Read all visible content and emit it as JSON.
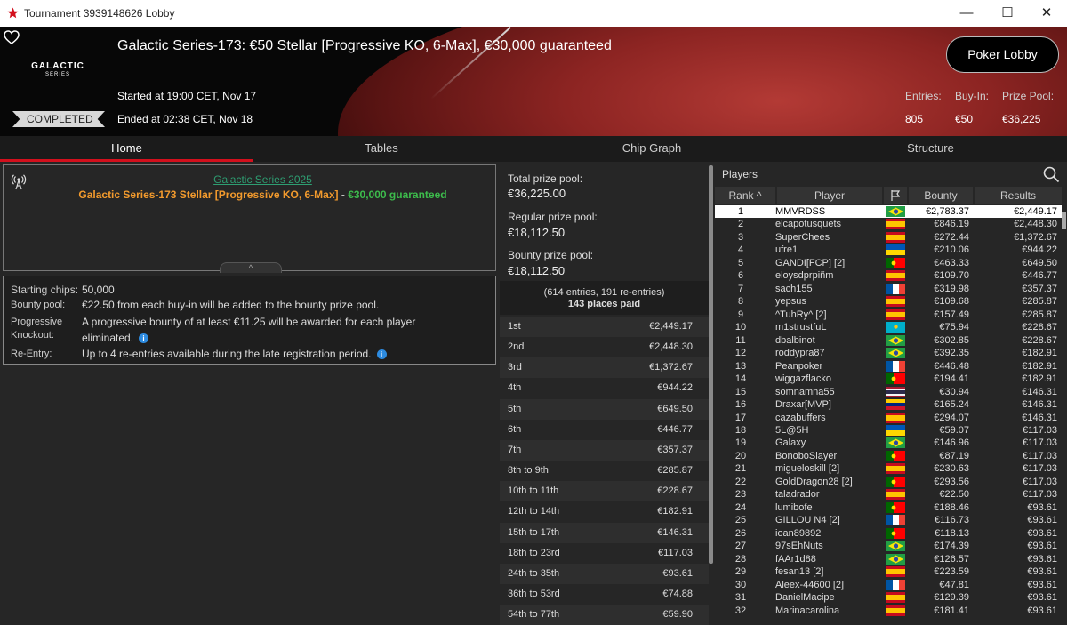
{
  "window": {
    "title": "Tournament 3939148626 Lobby",
    "minimize": "—",
    "maximize": "☐",
    "close": "✕"
  },
  "banner": {
    "logo_line1": "GALACTIC",
    "logo_line2": "SERIES",
    "title": "Galactic Series-173: €50 Stellar [Progressive KO, 6-Max], €30,000 guaranteed",
    "started": "Started at 19:00 CET, Nov 17",
    "ended": "Ended at 02:38 CET, Nov 18",
    "status": "COMPLETED",
    "lobby_button": "Poker Lobby",
    "stats": [
      {
        "label": "Entries:",
        "value": "805"
      },
      {
        "label": "Buy-In:",
        "value": "€50"
      },
      {
        "label": "Prize Pool:",
        "value": "€36,225"
      }
    ]
  },
  "tabs": [
    {
      "label": "Home"
    },
    {
      "label": "Tables"
    },
    {
      "label": "Chip Graph"
    },
    {
      "label": "Structure"
    }
  ],
  "info": {
    "series_link": "Galactic Series 2025",
    "title_orange": "Galactic Series-173 Stellar [Progressive KO, 6-Max]",
    "title_sep": " - ",
    "title_green": "€30,000 guaranteed",
    "collapse": "^"
  },
  "details": {
    "starting_label": "Starting chips:",
    "starting_value": "50,000",
    "bounty_label": "Bounty pool:",
    "bounty_value": "€22.50 from each buy-in will be added to the bounty prize pool.",
    "pko_label1": "Progressive",
    "pko_label2": "Knockout:",
    "pko_value1": "A progressive bounty of at least €11.25 will be awarded for each player",
    "pko_value2": "eliminated.",
    "reentry_label": "Re-Entry:",
    "reentry_value": "Up to 4 re-entries available during the late registration period."
  },
  "prize": {
    "total_label": "Total prize pool:",
    "total_value": "€36,225.00",
    "regular_label": "Regular prize pool:",
    "regular_value": "€18,112.50",
    "bounty_label": "Bounty prize pool:",
    "bounty_value": "€18,112.50",
    "entries_line": "(614 entries, 191 re-entries)",
    "paid_line": "143 places paid",
    "places": [
      [
        "1st",
        "€2,449.17"
      ],
      [
        "2nd",
        "€2,448.30"
      ],
      [
        "3rd",
        "€1,372.67"
      ],
      [
        "4th",
        "€944.22"
      ],
      [
        "5th",
        "€649.50"
      ],
      [
        "6th",
        "€446.77"
      ],
      [
        "7th",
        "€357.37"
      ],
      [
        "8th to 9th",
        "€285.87"
      ],
      [
        "10th to 11th",
        "€228.67"
      ],
      [
        "12th to 14th",
        "€182.91"
      ],
      [
        "15th to 17th",
        "€146.31"
      ],
      [
        "18th to 23rd",
        "€117.03"
      ],
      [
        "24th to 35th",
        "€93.61"
      ],
      [
        "36th to 53rd",
        "€74.88"
      ],
      [
        "54th to 77th",
        "€59.90"
      ]
    ]
  },
  "players": {
    "title": "Players",
    "col_rank": "Rank",
    "col_player": "Player",
    "col_bounty": "Bounty",
    "col_results": "Results",
    "sort_icon": "^",
    "rows": [
      [
        "1",
        "MMVRDSS",
        "br",
        "€2,783.37",
        "€2,449.17"
      ],
      [
        "2",
        "elcapotusquets",
        "es",
        "€846.19",
        "€2,448.30"
      ],
      [
        "3",
        "SuperChees",
        "es",
        "€272.44",
        "€1,372.67"
      ],
      [
        "4",
        "ufre1",
        "ua",
        "€210.06",
        "€944.22"
      ],
      [
        "5",
        "GANDI[FCP] [2]",
        "pt",
        "€463.33",
        "€649.50"
      ],
      [
        "6",
        "eloysdprpiñm",
        "es",
        "€109.70",
        "€446.77"
      ],
      [
        "7",
        "sach155",
        "fr",
        "€319.98",
        "€357.37"
      ],
      [
        "8",
        "yepsus",
        "es",
        "€109.68",
        "€285.87"
      ],
      [
        "9",
        "^TuhRy^ [2]",
        "es",
        "€157.49",
        "€285.87"
      ],
      [
        "10",
        "m1strustfuL",
        "kz",
        "€75.94",
        "€228.67"
      ],
      [
        "11",
        "dbalbinot",
        "br",
        "€302.85",
        "€228.67"
      ],
      [
        "12",
        "roddypra87",
        "br",
        "€392.35",
        "€182.91"
      ],
      [
        "13",
        "Peanpoker",
        "fr",
        "€446.48",
        "€182.91"
      ],
      [
        "14",
        "wiggazflacko",
        "pt",
        "€194.41",
        "€182.91"
      ],
      [
        "15",
        "somnamna55",
        "th",
        "€30.94",
        "€146.31"
      ],
      [
        "16",
        "Draxar[MVP]",
        "ve",
        "€165.24",
        "€146.31"
      ],
      [
        "17",
        "cazabuffers",
        "es",
        "€294.07",
        "€146.31"
      ],
      [
        "18",
        "5L@5H",
        "ua",
        "€59.07",
        "€117.03"
      ],
      [
        "19",
        "Galaxy",
        "br",
        "€146.96",
        "€117.03"
      ],
      [
        "20",
        "BonoboSlayer",
        "pt",
        "€87.19",
        "€117.03"
      ],
      [
        "21",
        "migueloskill [2]",
        "es",
        "€230.63",
        "€117.03"
      ],
      [
        "22",
        "GoldDragon28 [2]",
        "pt",
        "€293.56",
        "€117.03"
      ],
      [
        "23",
        "taladrador",
        "es",
        "€22.50",
        "€117.03"
      ],
      [
        "24",
        "lumibofe",
        "pt",
        "€188.46",
        "€93.61"
      ],
      [
        "25",
        "GILLOU N4 [2]",
        "fr",
        "€116.73",
        "€93.61"
      ],
      [
        "26",
        "ioan89892",
        "pt",
        "€118.13",
        "€93.61"
      ],
      [
        "27",
        "97sEhNuts",
        "br",
        "€174.39",
        "€93.61"
      ],
      [
        "28",
        "fAAr1d88",
        "br",
        "€126.57",
        "€93.61"
      ],
      [
        "29",
        "fesan13 [2]",
        "es",
        "€223.59",
        "€93.61"
      ],
      [
        "30",
        "Aleex-44600 [2]",
        "fr",
        "€47.81",
        "€93.61"
      ],
      [
        "31",
        "DanielMacipe",
        "es",
        "€129.39",
        "€93.61"
      ],
      [
        "32",
        "Marinacarolina",
        "es",
        "€181.41",
        "€93.61"
      ]
    ]
  },
  "colors": {
    "accent": "#d3101d",
    "link": "#2e9e72",
    "orange": "#f29a2d",
    "green": "#3dbb4c"
  }
}
